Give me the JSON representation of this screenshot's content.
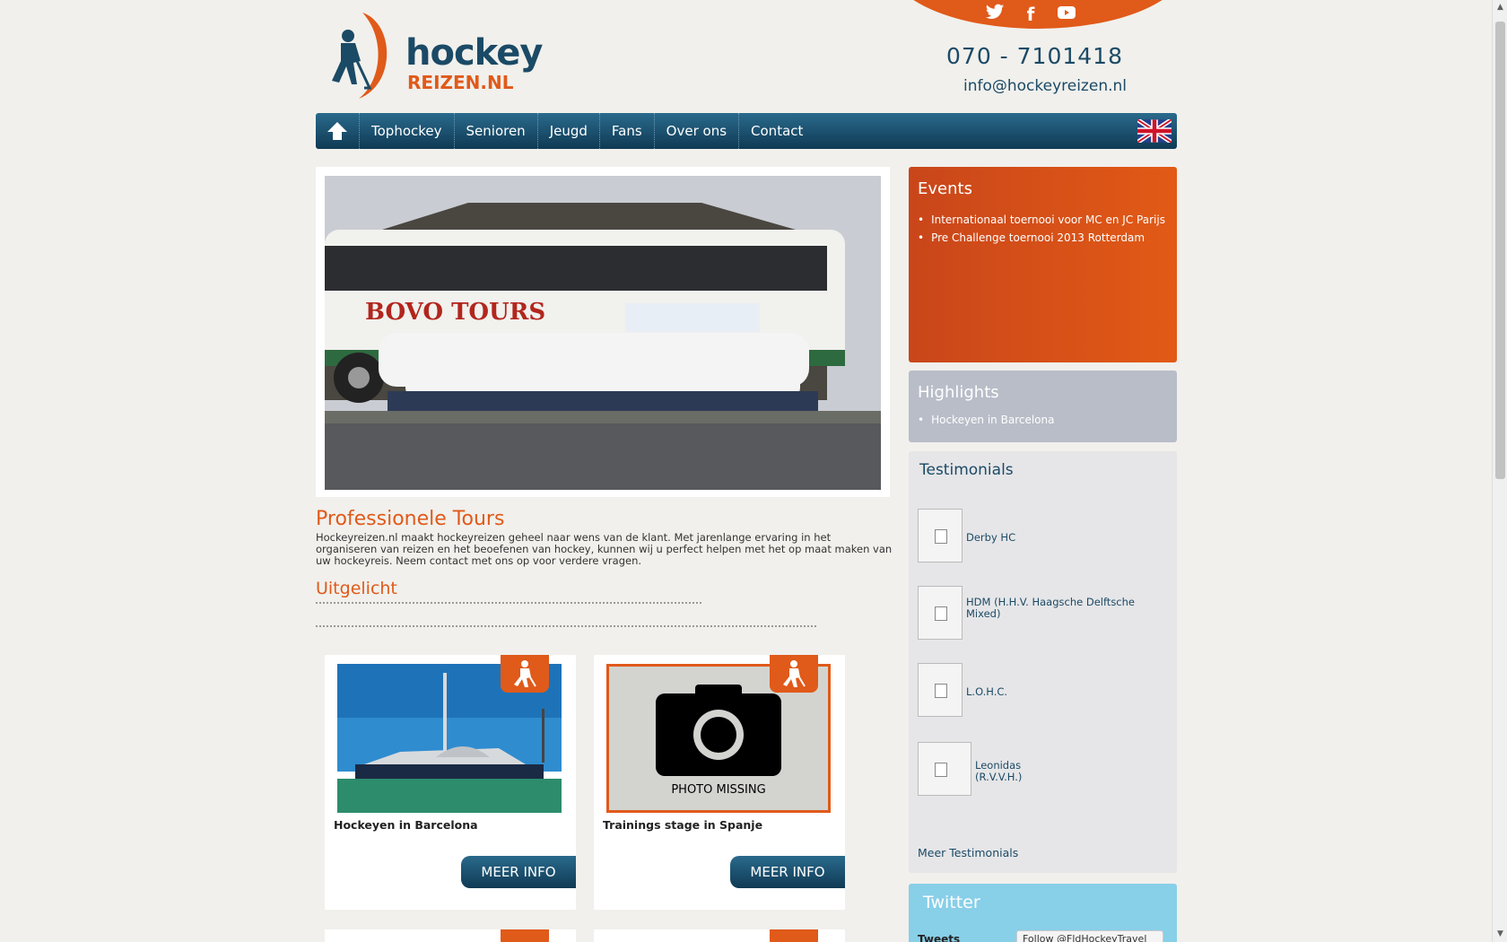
{
  "header": {
    "logo_word": "hockey",
    "logo_sub": "REIZEN.NL",
    "phone": "070 - 7101418",
    "email": "info@hockeyreizen.nl",
    "social": [
      "twitter-icon",
      "facebook-icon",
      "youtube-icon"
    ]
  },
  "nav": {
    "items": [
      "Tophockey",
      "Senioren",
      "Jeugd",
      "Fans",
      "Over ons",
      "Contact"
    ]
  },
  "hero": {
    "bus_text": "BOVO TOURS"
  },
  "main": {
    "title": "Professionele Tours",
    "intro": "Hockeyreizen.nl maakt hockeyreizen geheel naar wens van de klant. Met jarenlange ervaring in het organiseren van reizen en het beoefenen van hockey, kunnen wij u perfect helpen met het op maat maken van uw hockeyreis. Neem contact met ons op voor verdere vragen.",
    "section_title": "Uitgelicht",
    "cards": [
      {
        "caption": "Hockeyen in Barcelona",
        "button": "MEER INFO"
      },
      {
        "caption": "Trainings stage in Spanje",
        "button": "MEER INFO",
        "placeholder_text": "PHOTO MISSING"
      }
    ]
  },
  "sidebar": {
    "events": {
      "title": "Events",
      "items": [
        "Internationaal toernooi voor MC en JC Parijs",
        "Pre Challenge toernooi 2013 Rotterdam"
      ]
    },
    "highlights": {
      "title": "Highlights",
      "items": [
        "Hockeyen in Barcelona"
      ]
    },
    "testimonials": {
      "title": "Testimonials",
      "items": [
        "Derby HC",
        "HDM (H.H.V. Haagsche Delftsche Mixed)",
        "L.O.H.C.",
        "Leonidas (R.V.V.H.)"
      ],
      "more": "Meer Testimonials"
    },
    "twitter": {
      "title": "Twitter",
      "tweets_label": "Tweets",
      "follow": "Follow @FldHockeyTravel"
    }
  },
  "colors": {
    "accent": "#e05a1a",
    "navy": "#1b4a66",
    "twitter_bg": "#88cfe8"
  }
}
